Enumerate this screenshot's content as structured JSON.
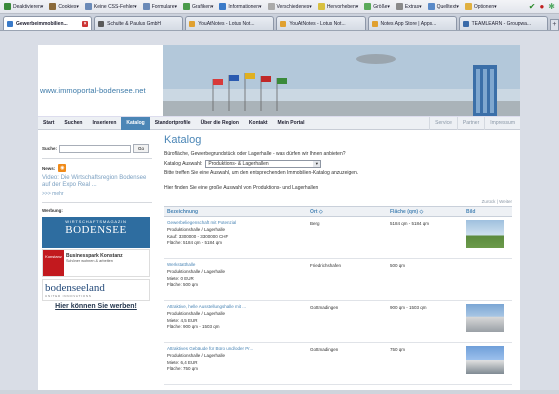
{
  "browser": {
    "toolbar": [
      {
        "label": "Deaktivieren▾",
        "color": "#3a8a3a"
      },
      {
        "label": "Cookies▾",
        "color": "#8a6a3a"
      },
      {
        "label": "Keine CSS-Fehler▾",
        "color": "#6a8ab8"
      },
      {
        "label": "Formulare▾",
        "color": "#6a8ab8"
      },
      {
        "label": "Grafiken▾",
        "color": "#4a9a4a"
      },
      {
        "label": "Informationen▾",
        "color": "#3a7ac8"
      },
      {
        "label": "Verschiedenes▾",
        "color": "#aaaaaa"
      },
      {
        "label": "Hervorheben▾",
        "color": "#d8c040"
      },
      {
        "label": "Größe▾",
        "color": "#5aaa5a"
      },
      {
        "label": "Extras▾",
        "color": "#8a8a8a"
      },
      {
        "label": "Quelltext▾",
        "color": "#5a8ac8"
      },
      {
        "label": "Optionen▾",
        "color": "#e0b040"
      }
    ],
    "tabs": [
      {
        "label": "Gewerbeimmobilien...",
        "active": true,
        "color": "#3a7ac8"
      },
      {
        "label": "Schulte & Paulus GmbH",
        "active": false,
        "color": "#5a5a5a"
      },
      {
        "label": "YouAtNotes - Lotus Not...",
        "active": false,
        "color": "#e0a030"
      },
      {
        "label": "YouAtNotes - Lotus Not...",
        "active": false,
        "color": "#e0a030"
      },
      {
        "label": "Notes App Store | Apps...",
        "active": false,
        "color": "#e0a030"
      },
      {
        "label": "TEAMLEARN - Groupwa...",
        "active": false,
        "color": "#3a6aa8"
      }
    ]
  },
  "site": {
    "logo": "www.immoportal-bodensee.net",
    "nav": [
      "Start",
      "Suchen",
      "Inserieren",
      "Katalog",
      "Standortprofile",
      "Über die Region",
      "Kontakt",
      "Mein Portal"
    ],
    "nav_active": "Katalog",
    "nav_right": [
      "Service",
      "Partner",
      "Impressum"
    ]
  },
  "sidebar": {
    "search_label": "Suche:",
    "search_button": "Go",
    "news_label": "News:",
    "news_text": "Video: Die Wirtschaftsregion Bodensee auf der Expo Real ...",
    "more": ">>> mehr",
    "ads_label": "Werbung:",
    "ad1_top": "WIRTSCHAFTSMAGAZIN",
    "ad1_main": "BODENSEE",
    "ad2_logo": "Konstanz",
    "ad2_title": "Businesspark Konstanz",
    "ad2_sub": "Schöner wohnen & arbeiten",
    "ad3_title": "bodenseeland",
    "ad3_sub": "UNITED INNOVATIONS",
    "ad4_text": "Hier können Sie werben!"
  },
  "main": {
    "title": "Katalog",
    "intro": "Bürofläche, Gewerbegrundstück oder Lagerhalle - was dürfen wir Ihnen anbieten?",
    "select_label": "Katalog Auswahl:",
    "select_value": "Produktions- & Lagerhallen",
    "hint": "Bitte treffen Sie eine Auswahl, um den entsprechenden Immobilien-Katalog anzuzeigen.",
    "found": "Hier finden Sie eine große Auswahl von Produktions- und Lagerhallen",
    "pager_prev": "Zurück",
    "pager_next": "Weiter",
    "columns": [
      "Bezeichnung",
      "Ort",
      "Fläche (qm)",
      "Bild"
    ],
    "rows": [
      {
        "title": "Gewerbeliegenschaft mit Potenzial",
        "type": "Produktionshalle / Lagerhalle",
        "price": "Kauf: 3300000 - 3300000 CHF",
        "area_line": "Fläche: 5184 qm - 5184 qm",
        "place": "Berg",
        "area": "5184 qm - 5184 qm",
        "thumb": "th1"
      },
      {
        "title": "Werkstatthalle",
        "type": "Produktionshalle / Lagerhalle",
        "price": "Miete: 0 EUR",
        "area_line": "Fläche: 500 qm",
        "place": "Friedrichshafen",
        "area": "500 qm",
        "thumb": "th2"
      },
      {
        "title": "Attraktive, helle Ausstellungshalle mit ...",
        "type": "Produktionshalle / Lagerhalle",
        "price": "Miete: 4,5 EUR",
        "area_line": "Fläche: 900 qm - 1503 qm",
        "place": "Gottmadingen",
        "area": "900 qm - 1503 qm",
        "thumb": "th3"
      },
      {
        "title": "Attraktives Gebäude für Büro und/oder Pr...",
        "type": "Produktionshalle / Lagerhalle",
        "price": "Miete: 6,4 EUR",
        "area_line": "Fläche: 750 qm",
        "place": "Gottmadingen",
        "area": "750 qm",
        "thumb": "th4"
      }
    ]
  }
}
